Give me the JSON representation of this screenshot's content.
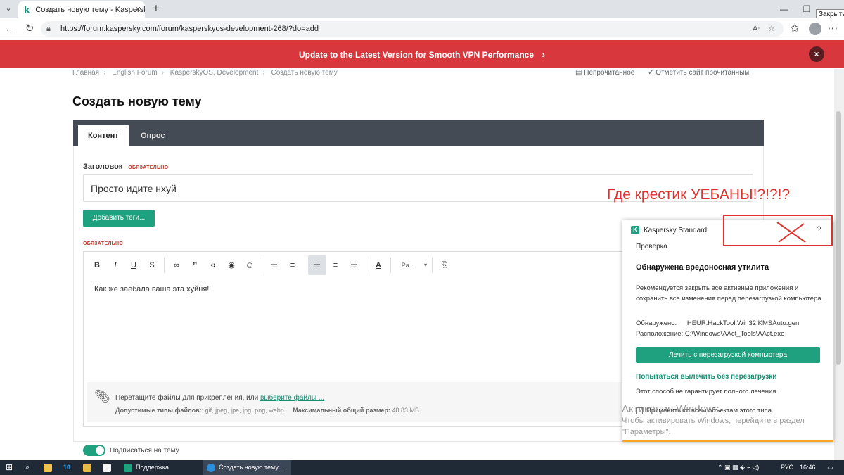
{
  "browser": {
    "tab_title": "Создать новую тему - Kaspersky",
    "tab_favicon": "k",
    "url": "https://forum.kaspersky.com/forum/kasperskyos-development-268/?do=add",
    "close_tooltip": "Закрыть"
  },
  "banner": {
    "text": "Update to the Latest Version for Smooth VPN Performance",
    "arrow": "›",
    "close": "×"
  },
  "breadcrumb": {
    "items": [
      "Главная",
      "English Forum",
      "KasperskyOS, Development",
      "Создать новую тему"
    ],
    "separator": "›"
  },
  "header_links": {
    "unread": "Непрочитанное",
    "mark_read": "Отметить сайт прочитанным"
  },
  "page": {
    "title": "Создать новую тему"
  },
  "tabs": [
    {
      "label": "Контент",
      "active": true
    },
    {
      "label": "Опрос",
      "active": false
    }
  ],
  "form": {
    "title_label": "Заголовок",
    "required": "ОБЯЗАТЕЛЬНО",
    "title_value": "Просто идите нхуй",
    "add_tags": "Добавить теги...",
    "body_required": "ОБЯЗАТЕЛЬНО",
    "body_text": "Как же заебала ваша эта хуйня!",
    "toolbar": [
      "B",
      "I",
      "U",
      "S",
      "link",
      "quote",
      "code",
      "preview",
      "emoji",
      "bullets",
      "numbered",
      "align-left",
      "align-center",
      "align-right",
      "text-color",
      "Pa...",
      "spellcheck"
    ],
    "attach_text": "Перетащите файлы для прикрепления, или",
    "attach_link": "выберите файлы ...",
    "allowed_label": "Допустимые типы файлов:",
    "allowed_types": ": gif, jpeg, jpe, jpg, png, webp",
    "max_label": "Максимальный общий размер:",
    "max_size": "48.83 MB",
    "subscribe": "Подписаться на тему"
  },
  "annotation": {
    "text": "Где крестик УЕБАНЫ!?!?!?"
  },
  "kaspersky": {
    "product": "Kaspersky Standard",
    "help": "?",
    "section": "Проверка",
    "title": "Обнаружена вредоносная утилита",
    "description": "Рекомендуется закрыть все активные приложения и сохранить все изменения перед перезагрузкой компьютера.",
    "detected_label": "Обнаружено:",
    "detected_value": "HEUR:HackTool.Win32.KMSAuto.gen",
    "location_label": "Расположение:",
    "location_value": "C:\\Windows\\AAct_Tools\\AAct.exe",
    "primary_button": "Лечить с перезагрузкой компьютера",
    "alt_link": "Попытаться вылечить без перезагрузки",
    "alt_note": "Этот способ не гарантирует полного лечения.",
    "apply_all": "Применить ко всем объектам этого типа"
  },
  "watermark": {
    "line1": "Активация Windows",
    "line2": "Чтобы активировать Windows, перейдите в раздел",
    "line3": "\"Параметры\"."
  },
  "taskbar": {
    "apps": [
      {
        "label": "Поддержка",
        "active": false
      },
      {
        "label": "Создать новую тему ...",
        "active": true
      }
    ],
    "lang": "РУС",
    "time": "16:46"
  },
  "colors": {
    "banner": "#d9373e",
    "accent": "#1fa07e",
    "annotation": "#e0302d",
    "tabs_bg": "#454b55"
  }
}
